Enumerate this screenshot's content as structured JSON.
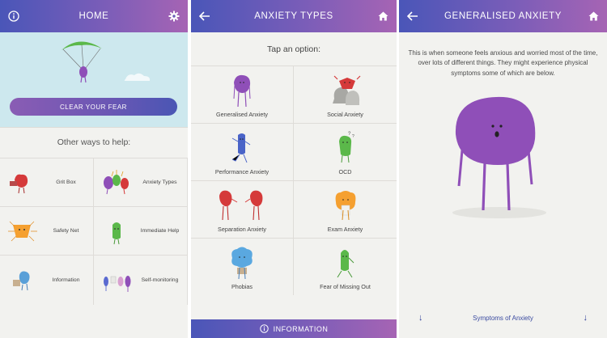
{
  "colors": {
    "header_start": "#4a56b8",
    "header_end": "#a664b4",
    "hero_bg": "#cde8ee",
    "accent_purple": "#8f4fb8"
  },
  "home": {
    "title": "HOME",
    "info_icon": "info-icon",
    "settings_icon": "gear-icon",
    "cta_label": "CLEAR YOUR FEAR",
    "other_ways_label": "Other ways to help:",
    "tiles": [
      {
        "label": "Grit Box",
        "icon": "grit-box-character"
      },
      {
        "label": "Anxiety Types",
        "icon": "anxiety-types-characters"
      },
      {
        "label": "Safety Net",
        "icon": "safety-net-character"
      },
      {
        "label": "Immediate Help",
        "icon": "immediate-help-character"
      },
      {
        "label": "Information",
        "icon": "information-character"
      },
      {
        "label": "Self-monitoring",
        "icon": "self-monitoring-characters"
      }
    ]
  },
  "anxiety_types": {
    "title": "ANXIETY TYPES",
    "back_icon": "back-arrow-icon",
    "home_icon": "home-icon",
    "prompt": "Tap an option:",
    "options": [
      {
        "label": "Generalised Anxiety",
        "icon": "purple-blob-character"
      },
      {
        "label": "Social Anxiety",
        "icon": "red-character-with-rocks"
      },
      {
        "label": "Performance Anxiety",
        "icon": "blue-dancing-character"
      },
      {
        "label": "OCD",
        "icon": "green-confused-character"
      },
      {
        "label": "Separation Anxiety",
        "icon": "red-pair-characters"
      },
      {
        "label": "Exam Anxiety",
        "icon": "orange-character-with-paper"
      },
      {
        "label": "Phobias",
        "icon": "blue-fluffy-character"
      },
      {
        "label": "Fear of Missing Out",
        "icon": "green-sitting-character"
      }
    ],
    "info_bar_label": "INFORMATION"
  },
  "generalised": {
    "title": "GENERALISED ANXIETY",
    "back_icon": "back-arrow-icon",
    "home_icon": "home-icon",
    "description": "This is when someone feels anxious and worried most of the time, over lots of different things. They might experience physical symptoms some of which are below.",
    "symptoms_label": "Symptoms of Anxiety"
  }
}
